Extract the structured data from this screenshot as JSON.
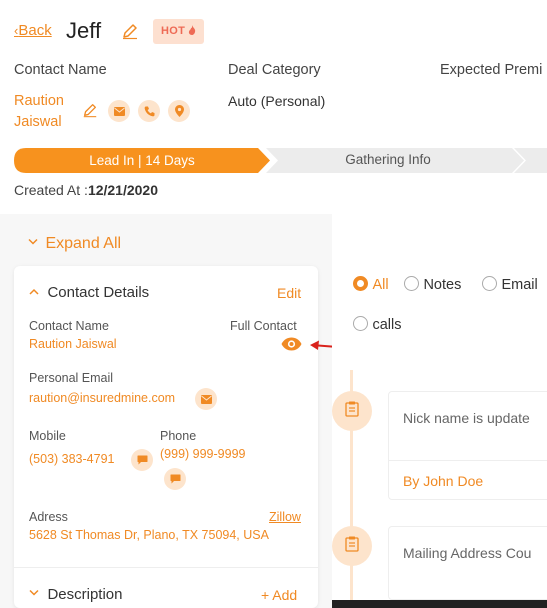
{
  "header": {
    "back_arrow": "‹",
    "back_label": "Back",
    "title": "Jeff",
    "hot_label": "HOT"
  },
  "columns": {
    "contact_name_label": "Contact Name",
    "deal_category_label": "Deal Category",
    "expected_premium_label": "Expected Premi"
  },
  "contact": {
    "name_line1": "Raution",
    "name_line2": "Jaiswal",
    "deal_category": "Auto (Personal)"
  },
  "stages": [
    {
      "label": "Lead In | 14 Days",
      "active": true
    },
    {
      "label": "Gathering Info",
      "active": false
    }
  ],
  "created": {
    "label": "Created At :",
    "value": "12/21/2020"
  },
  "left_panel": {
    "expand_all": "Expand All",
    "contact_details_title": "Contact Details",
    "edit_label": "Edit",
    "contact_name_label": "Contact Name",
    "contact_name_value": "Raution Jaiswal",
    "full_contact_label": "Full Contact",
    "personal_email_label": "Personal Email",
    "personal_email_value": "raution@insuredmine.com",
    "mobile_label": "Mobile",
    "mobile_value": "(503) 383-4791",
    "phone_label": "Phone",
    "phone_value": "(999) 999-9999",
    "address_label": "Adress",
    "zillow_label": "Zillow",
    "address_value": "5628 St Thomas Dr, Plano, TX 75094, USA",
    "description_title": "Description",
    "add_label": "+ Add"
  },
  "filters": {
    "options": [
      "All",
      "Notes",
      "Email",
      "calls"
    ],
    "selected": "All"
  },
  "timeline": [
    {
      "text": "Nick name is update",
      "author": "By John Doe",
      "icon": "note-icon"
    },
    {
      "text": "Mailing Address Cou",
      "icon": "note-icon"
    }
  ],
  "colors": {
    "accent": "#f08a24",
    "accent_light": "#fde4cc",
    "hot_bg": "#fde0d0",
    "arrow_red": "#d9221c"
  }
}
